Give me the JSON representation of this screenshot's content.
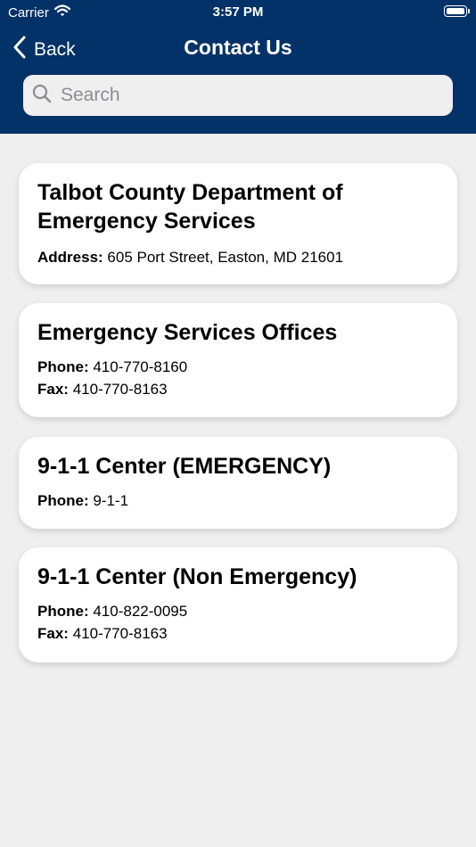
{
  "status_bar": {
    "carrier": "Carrier",
    "time": "3:57 PM"
  },
  "nav": {
    "back_label": "Back",
    "title": "Contact Us"
  },
  "search": {
    "placeholder": "Search",
    "value": ""
  },
  "colors": {
    "header": "#033268",
    "background": "#efefef",
    "card": "#ffffff"
  },
  "contacts": [
    {
      "title": "Talbot County Department of Emergency Services",
      "lines": [
        {
          "label": "Address:",
          "value": "605 Port Street, Easton, MD 21601"
        }
      ]
    },
    {
      "title": "Emergency Services Offices",
      "lines": [
        {
          "label": "Phone:",
          "value": "410-770-8160"
        },
        {
          "label": "Fax:",
          "value": "410-770-8163"
        }
      ]
    },
    {
      "title": "9-1-1 Center (EMERGENCY)",
      "lines": [
        {
          "label": "Phone:",
          "value": "9-1-1"
        }
      ]
    },
    {
      "title": "9-1-1 Center (Non Emergency)",
      "lines": [
        {
          "label": "Phone:",
          "value": "410-822-0095"
        },
        {
          "label": "Fax:",
          "value": "410-770-8163"
        }
      ]
    }
  ]
}
